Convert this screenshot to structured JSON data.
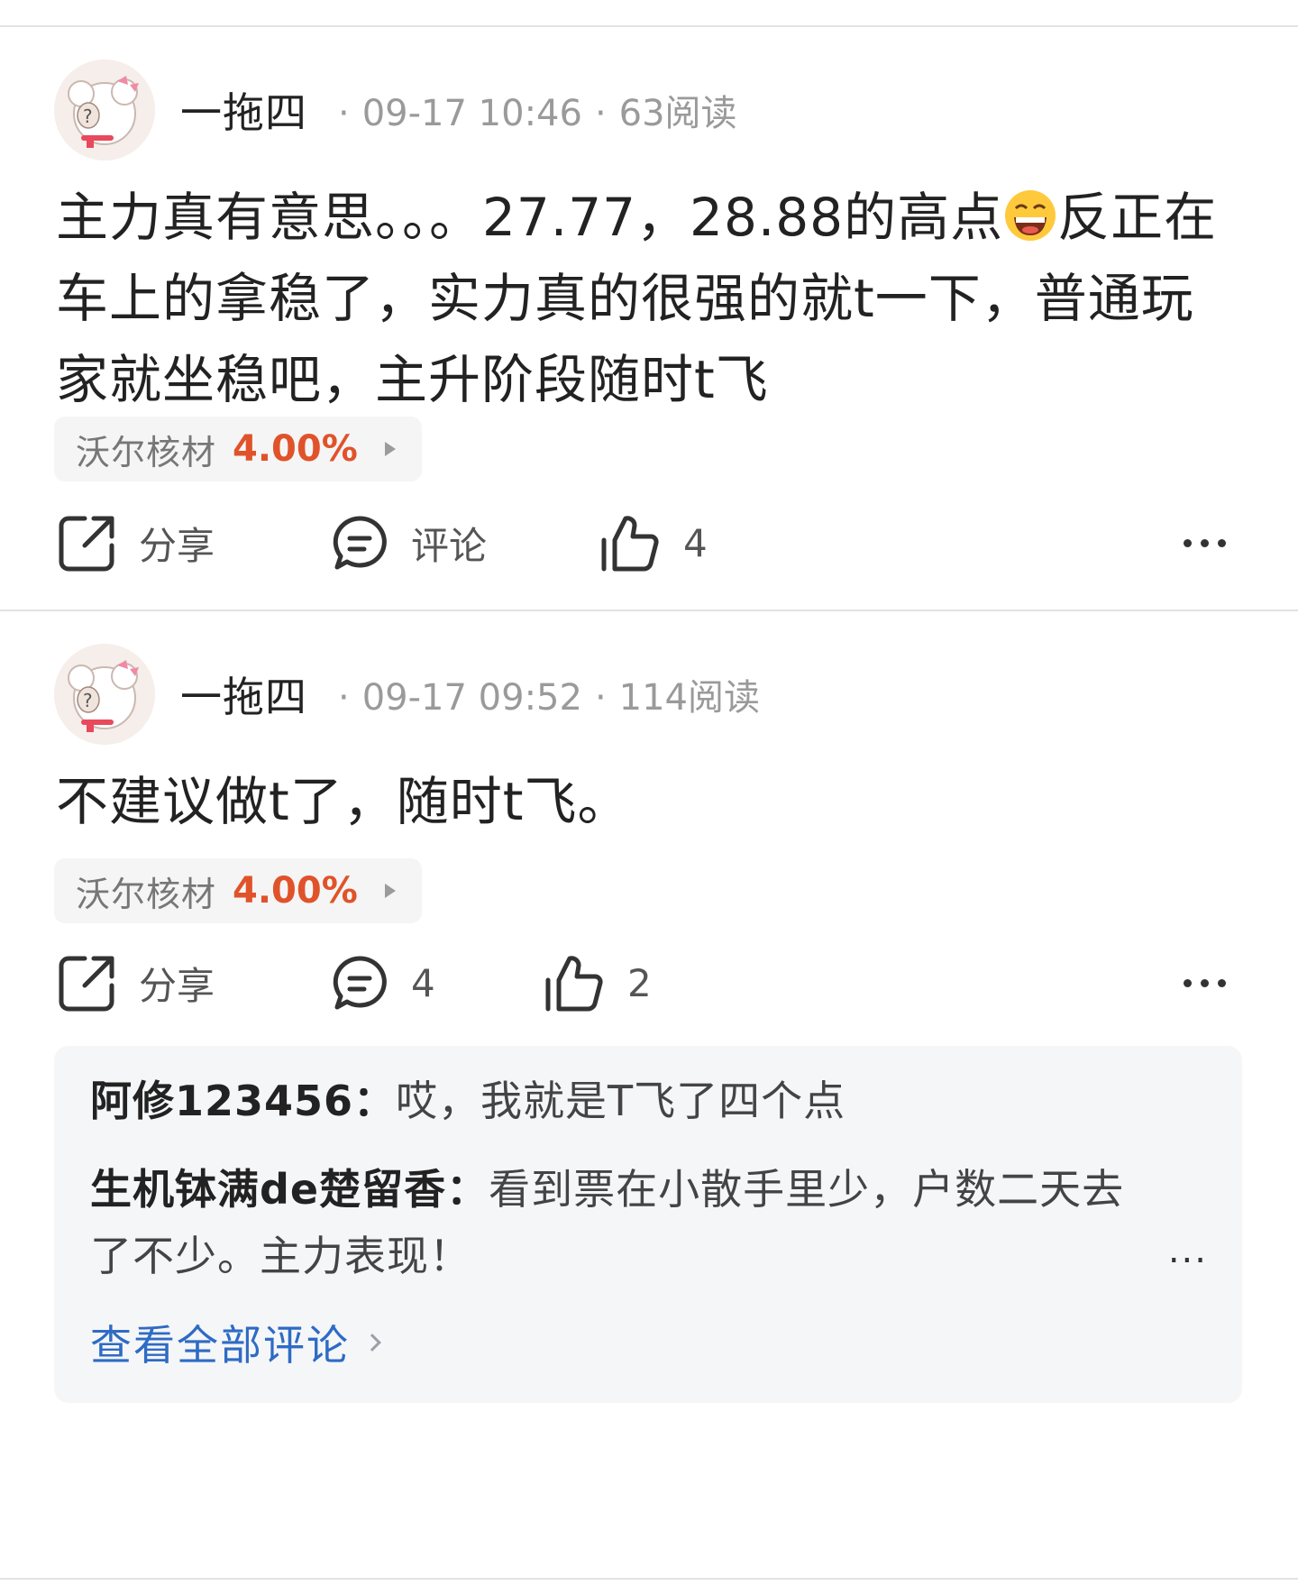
{
  "posts": [
    {
      "author": "一拖四",
      "date": "09-17 10:46",
      "reads": "63阅读",
      "text_before_emoji": "主力真有意思。。。27.77，28.88的高点",
      "emoji": "laughing-emoji",
      "text_after_emoji": "反正在车上的拿稳了，实力真的很强的就t一下，普通玩家就坐稳吧，主升阶段随时t飞",
      "stock": {
        "name": "沃尔核材",
        "change": "4.00%"
      },
      "actions": {
        "share": "分享",
        "comment": "评论",
        "likes": "4"
      }
    },
    {
      "author": "一拖四",
      "date": "09-17 09:52",
      "reads": "114阅读",
      "text": "不建议做t了，随时t飞。",
      "stock": {
        "name": "沃尔核材",
        "change": "4.00%"
      },
      "actions": {
        "share": "分享",
        "comments": "4",
        "likes": "2"
      },
      "comments": [
        {
          "name": "阿修123456",
          "sep": "：",
          "text": "哎，我就是T飞了四个点"
        },
        {
          "name": "生机钵满de楚留香",
          "sep": "：",
          "text": "看到票在小散手里少，户数二天去了不少。主力表现！"
        }
      ],
      "view_all": "查看全部评论"
    }
  ],
  "colors": {
    "accent_red": "#e0532a",
    "link_blue": "#2e6bc4",
    "muted": "#9a9a9a"
  },
  "icons": [
    "avatar-sheep",
    "share-icon",
    "comment-icon",
    "thumbs-up-icon",
    "more-dots-icon"
  ]
}
